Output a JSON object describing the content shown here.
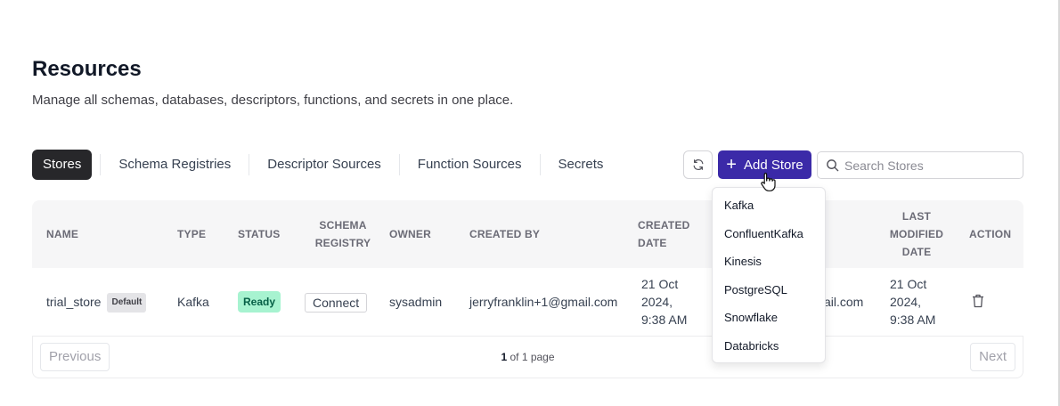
{
  "header": {
    "title": "Resources",
    "subtitle": "Manage all schemas, databases, descriptors, functions, and secrets in one place."
  },
  "tabs": [
    {
      "label": "Stores",
      "active": true
    },
    {
      "label": "Schema Registries",
      "active": false
    },
    {
      "label": "Descriptor Sources",
      "active": false
    },
    {
      "label": "Function Sources",
      "active": false
    },
    {
      "label": "Secrets",
      "active": false
    }
  ],
  "toolbar": {
    "refresh_icon": "refresh-icon",
    "add_label": "Add Store",
    "search_placeholder": "Search Stores"
  },
  "table": {
    "columns": {
      "name": "NAME",
      "type": "TYPE",
      "status": "STATUS",
      "schema_registry": "SCHEMA REGISTRY",
      "owner": "OWNER",
      "created_by": "CREATED BY",
      "created_date": "CREATED DATE",
      "last_modified_date": "LAST MODIFIED DATE",
      "action": "ACTION"
    },
    "rows": [
      {
        "name": "trial_store",
        "default_badge": "Default",
        "type": "Kafka",
        "status": "Ready",
        "schema_registry": "Connect",
        "owner": "sysadmin",
        "created_by": "jerryfranklin+1@gmail.com",
        "created_date": "21 Oct 2024, 9:38 AM",
        "modified_by_partial": "ail.com",
        "last_modified_date": "21 Oct 2024, 9:38 AM",
        "action_icon": "trash-icon"
      }
    ]
  },
  "pagination": {
    "previous_label": "Previous",
    "next_label": "Next",
    "current_page": "1",
    "page_suffix": "of 1 page"
  },
  "add_store_menu": {
    "items": [
      "Kafka",
      "ConfluentKafka",
      "Kinesis",
      "PostgreSQL",
      "Snowflake",
      "Databricks"
    ]
  },
  "colors": {
    "accent": "#3b2aa8",
    "tab_active_bg": "#27272a",
    "ready_bg": "#a7f3d0",
    "ready_text": "#065f46"
  }
}
